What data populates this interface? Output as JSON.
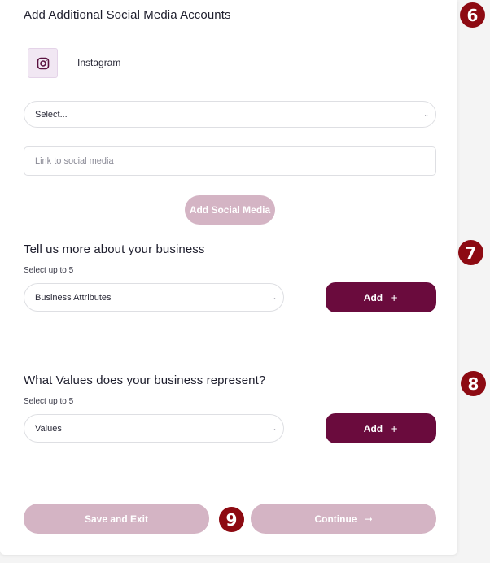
{
  "social": {
    "heading": "Add Additional Social Media Accounts",
    "platform_label": "Instagram",
    "platform_icon": "instagram-icon",
    "select_value": "Select...",
    "link_placeholder": "Link to social media",
    "add_button": "Add Social Media"
  },
  "business": {
    "heading": "Tell us more about your business",
    "hint": "Select up to 5",
    "select_value": "Business Attributes",
    "add_button": "Add",
    "add_icon": "+"
  },
  "values": {
    "heading": "What Values does your business represent?",
    "hint": "Select up to 5",
    "select_value": "Values",
    "add_button": "Add",
    "add_icon": "+"
  },
  "footer": {
    "save_exit": "Save and Exit",
    "continue": "Continue",
    "continue_icon": "→"
  },
  "markers": [
    "6",
    "7",
    "8",
    "9"
  ],
  "colors": {
    "accent_dark": "#6a0b3d",
    "accent_light": "#d4b4c4",
    "marker": "#8d0a12"
  }
}
